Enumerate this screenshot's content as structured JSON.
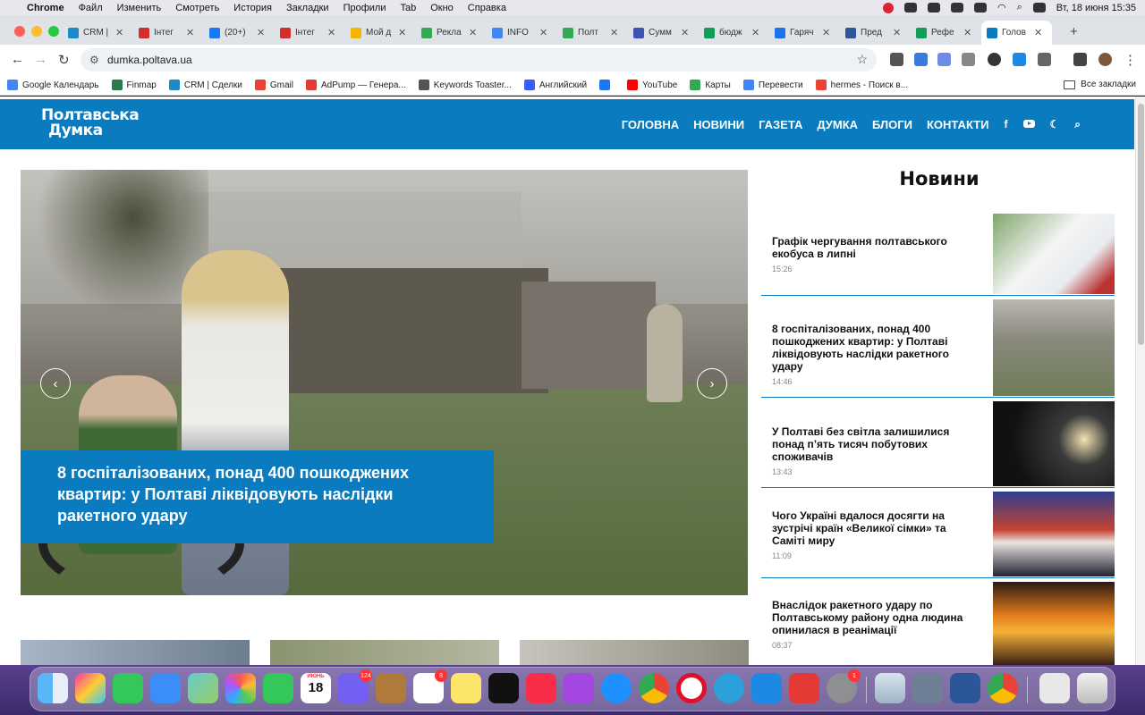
{
  "menubar": {
    "app": "Chrome",
    "items": [
      "Файл",
      "Изменить",
      "Смотреть",
      "История",
      "Закладки",
      "Профили",
      "Tab",
      "Окно",
      "Справка"
    ],
    "datetime": "Вт, 18 июня  15:35"
  },
  "tabs": [
    {
      "title": "CRM |",
      "color": "#1a8ac9"
    },
    {
      "title": "Інтег",
      "color": "#d32f2f"
    },
    {
      "title": "(20+)",
      "color": "#1877f2"
    },
    {
      "title": "Інтег",
      "color": "#d32f2f"
    },
    {
      "title": "Мой д",
      "color": "#f4b400"
    },
    {
      "title": "Рекла",
      "color": "#34a853"
    },
    {
      "title": "INFO",
      "color": "#4285f4"
    },
    {
      "title": "Полт",
      "color": "#34a853"
    },
    {
      "title": "Сумм",
      "color": "#3f51b5"
    },
    {
      "title": "бюдж",
      "color": "#0f9d58"
    },
    {
      "title": "Гаряч",
      "color": "#1a73e8"
    },
    {
      "title": "Пред",
      "color": "#2b579a"
    },
    {
      "title": "Рефе",
      "color": "#0f9d58"
    },
    {
      "title": "Голов",
      "color": "#0a7bbf"
    }
  ],
  "omnibox": {
    "url": "dumka.poltava.ua"
  },
  "bookmarks": [
    {
      "label": "Google Календарь",
      "color": "#4285f4"
    },
    {
      "label": "Finmap",
      "color": "#2a7a4a"
    },
    {
      "label": "CRM | Сделки",
      "color": "#1a8ac9"
    },
    {
      "label": "Gmail",
      "color": "#ea4335"
    },
    {
      "label": "AdPump — Генера...",
      "color": "#e53935"
    },
    {
      "label": "Keywords Toaster...",
      "color": "#555555"
    },
    {
      "label": "Английский",
      "color": "#3d5afe"
    },
    {
      "label": "",
      "color": "#1877f2"
    },
    {
      "label": "YouTube",
      "color": "#ff0000"
    },
    {
      "label": "Карты",
      "color": "#34a853"
    },
    {
      "label": "Перевести",
      "color": "#4285f4"
    },
    {
      "label": "hermes - Поиск в...",
      "color": "#ea4335"
    }
  ],
  "bookmarks_all": "Все закладки",
  "site": {
    "logo_line1": "Полтавська",
    "logo_line2": "Думка",
    "nav": [
      "ГОЛОВНА",
      "НОВИНИ",
      "ГАЗЕТА",
      "ДУМКА",
      "БЛОГИ",
      "КОНТАКТИ"
    ],
    "accent": "#0a7bbf"
  },
  "hero": {
    "caption": "8 госпіталізованих, понад 400 пошкоджених квартир: у Полтаві ліквідовують наслідки ракетного удару"
  },
  "news": {
    "title": "Новини",
    "items": [
      {
        "title": "Графік чергування полтавського екобуса в липні",
        "time": "15:26"
      },
      {
        "title": "8 госпіталізованих, понад 400 пошкоджених квартир: у Полтаві ліквідовують наслідки ракетного удару",
        "time": "14:46"
      },
      {
        "title": "У Полтаві без світла залишилися понад п’ять тисяч побутових споживачів",
        "time": "13:43"
      },
      {
        "title": "Чого Україні вдалося досягти на зустрічі країн «Великої сімки» та Саміті миру",
        "time": "11:09"
      },
      {
        "title": "Внаслідок ракетного удару по Полтавському району одна людина опинилася в реанімації",
        "time": "08:37"
      }
    ]
  },
  "dock": {
    "calendar_month": "ИЮНЬ",
    "calendar_day": "18",
    "viber_badge": "124",
    "reminders_badge": "8",
    "settings_badge": "1"
  }
}
